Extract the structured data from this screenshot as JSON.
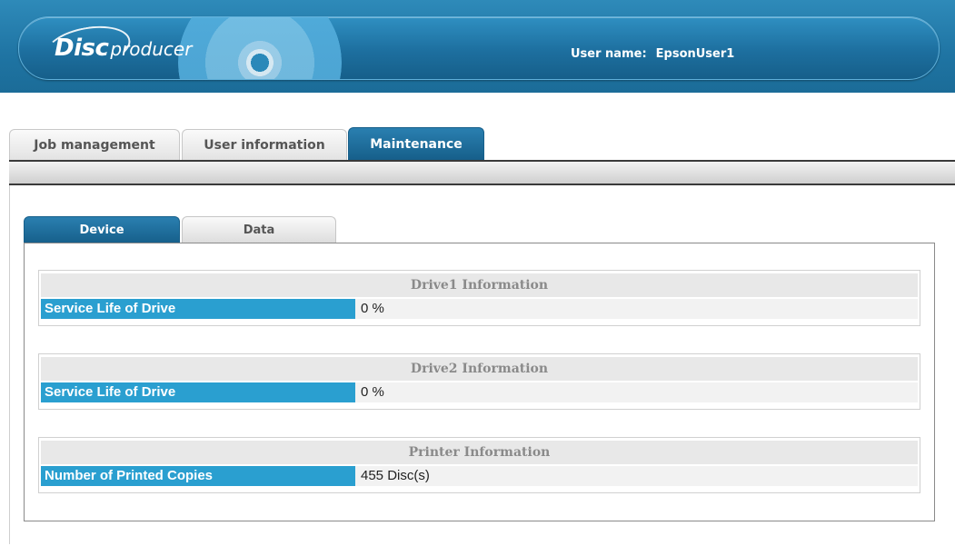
{
  "header": {
    "logo_disc": "Disc",
    "logo_producer": "producer",
    "user_name_label": "User name:",
    "user_name_value": "EpsonUser1"
  },
  "main_tabs": [
    {
      "label": "Job management",
      "active": false
    },
    {
      "label": "User information",
      "active": false
    },
    {
      "label": "Maintenance",
      "active": true
    }
  ],
  "sub_tabs": [
    {
      "label": "Device",
      "active": true
    },
    {
      "label": "Data",
      "active": false
    }
  ],
  "sections": [
    {
      "title": "Drive1 Information",
      "label": "Service Life of Drive",
      "value": "0 %"
    },
    {
      "title": "Drive2 Information",
      "label": "Service Life of Drive",
      "value": "0 %"
    },
    {
      "title": "Printer Information",
      "label": "Number of Printed Copies",
      "value": "455 Disc(s)"
    }
  ],
  "colors": {
    "header_blue": "#1f74a3",
    "active_tab": "#165f8a",
    "label_blue": "#2a9fd0"
  }
}
